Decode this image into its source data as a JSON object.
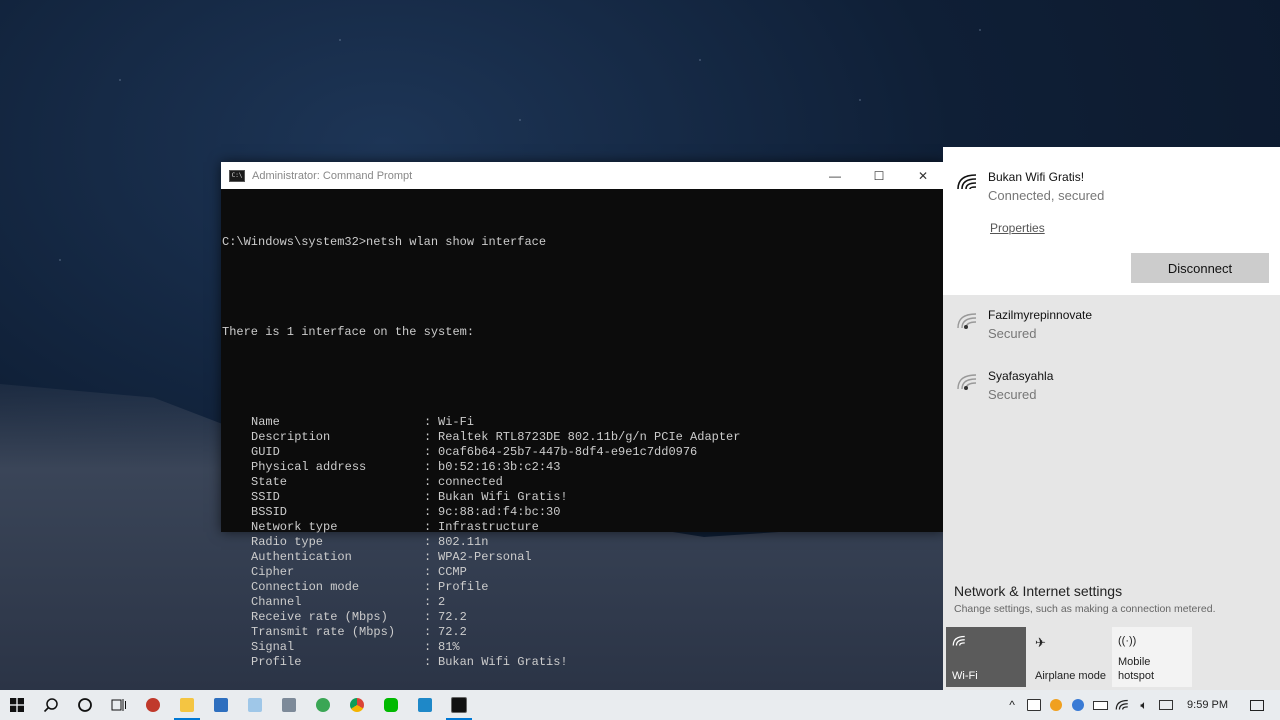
{
  "cmd": {
    "title": "Administrator: Command Prompt",
    "icon": "C:\\",
    "controls": {
      "minimize": "—",
      "maximize": "☐",
      "close": "✕"
    },
    "command": "C:\\Windows\\system32>netsh wlan show interface",
    "summary": "There is 1 interface on the system:",
    "rows": [
      {
        "label": "Name",
        "value": "Wi-Fi"
      },
      {
        "label": "Description",
        "value": "Realtek RTL8723DE 802.11b/g/n PCIe Adapter"
      },
      {
        "label": "GUID",
        "value": "0caf6b64-25b7-447b-8df4-e9e1c7dd0976"
      },
      {
        "label": "Physical address",
        "value": "b0:52:16:3b:c2:43"
      },
      {
        "label": "State",
        "value": "connected"
      },
      {
        "label": "SSID",
        "value": "Bukan Wifi Gratis!"
      },
      {
        "label": "BSSID",
        "value": "9c:88:ad:f4:bc:30"
      },
      {
        "label": "Network type",
        "value": "Infrastructure"
      },
      {
        "label": "Radio type",
        "value": "802.11n"
      },
      {
        "label": "Authentication",
        "value": "WPA2-Personal"
      },
      {
        "label": "Cipher",
        "value": "CCMP"
      },
      {
        "label": "Connection mode",
        "value": "Profile"
      },
      {
        "label": "Channel",
        "value": "2"
      },
      {
        "label": "Receive rate (Mbps)",
        "value": "72.2"
      },
      {
        "label": "Transmit rate (Mbps)",
        "value": "72.2"
      },
      {
        "label": "Signal",
        "value": "81%"
      },
      {
        "label": "Profile",
        "value": "Bukan Wifi Gratis!"
      }
    ]
  },
  "network": {
    "connected": {
      "name": "Bukan Wifi Gratis!",
      "status": "Connected, secured",
      "properties": "Properties",
      "disconnect": "Disconnect"
    },
    "others": [
      {
        "name": "Fazilmyrepinnovate",
        "status": "Secured"
      },
      {
        "name": "Syafasyahla",
        "status": "Secured"
      }
    ],
    "settings_title": "Network & Internet settings",
    "settings_sub": "Change settings, such as making a connection metered.",
    "tiles": {
      "wifi": "Wi-Fi",
      "airplane": "Airplane mode",
      "hotspot_line1": "Mobile",
      "hotspot_line2": "hotspot"
    }
  },
  "taskbar": {
    "apps": [
      "start-icon",
      "search-icon",
      "cortana-icon",
      "task-view-icon",
      "app-icon",
      "file-explorer-icon",
      "mail-icon",
      "notepad-icon",
      "photos-icon",
      "app-icon",
      "chrome-icon",
      "line-icon",
      "app-icon",
      "command-prompt-icon"
    ],
    "clock": "9:59 PM"
  },
  "colors": {
    "cmd_bg": "#0c0c0c",
    "cmd_text": "#cccccc",
    "accent": "#0078d4",
    "tile_active": "#5b5b5b"
  }
}
